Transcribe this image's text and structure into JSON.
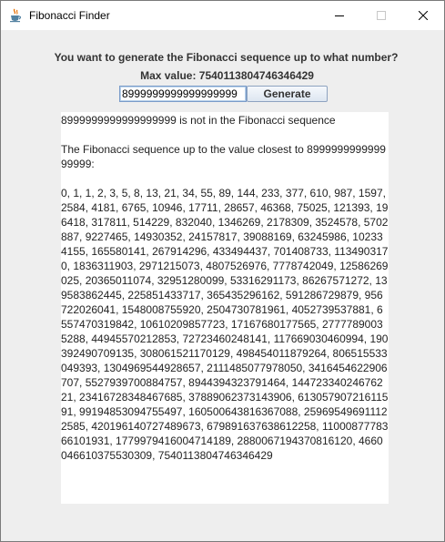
{
  "window": {
    "title": "Fibonacci Finder",
    "icon": "java-cup-icon"
  },
  "form": {
    "prompt": "You want to generate the Fibonacci sequence up to what number?",
    "max_value": "Max value: 7540113804746346429",
    "input_value": "8999999999999999999",
    "generate_label": "Generate"
  },
  "output": {
    "text": "8999999999999999999 is not in the Fibonacci sequence\n\nThe Fibonacci sequence up to the value closest to 899999999999999999:\n\n0, 1, 1, 2, 3, 5, 8, 13, 21, 34, 55, 89, 144, 233, 377, 610, 987, 1597, 2584, 4181, 6765, 10946, 17711, 28657, 46368, 75025, 121393, 196418, 317811, 514229, 832040, 1346269, 2178309, 3524578, 5702887, 9227465, 14930352, 24157817, 39088169, 63245986, 102334155, 165580141, 267914296, 433494437, 701408733, 1134903170, 1836311903, 2971215073, 4807526976, 7778742049, 12586269025, 20365011074, 32951280099, 53316291173, 86267571272, 139583862445, 225851433717, 365435296162, 591286729879, 956722026041, 1548008755920, 2504730781961, 4052739537881, 6557470319842, 10610209857723, 17167680177565, 27777890035288, 44945570212853, 72723460248141, 117669030460994, 190392490709135, 308061521170129, 498454011879264, 806515533049393, 1304969544928657, 2111485077978050, 3416454622906707, 5527939700884757, 8944394323791464, 14472334024676221, 23416728348467685, 37889062373143906, 61305790721611591, 99194853094755497, 160500643816367088, 259695496911122585, 420196140727489673, 679891637638612258, 1100087778366101931, 1779979416004714189, 2880067194370816120, 4660046610375530309, 7540113804746346429"
  }
}
